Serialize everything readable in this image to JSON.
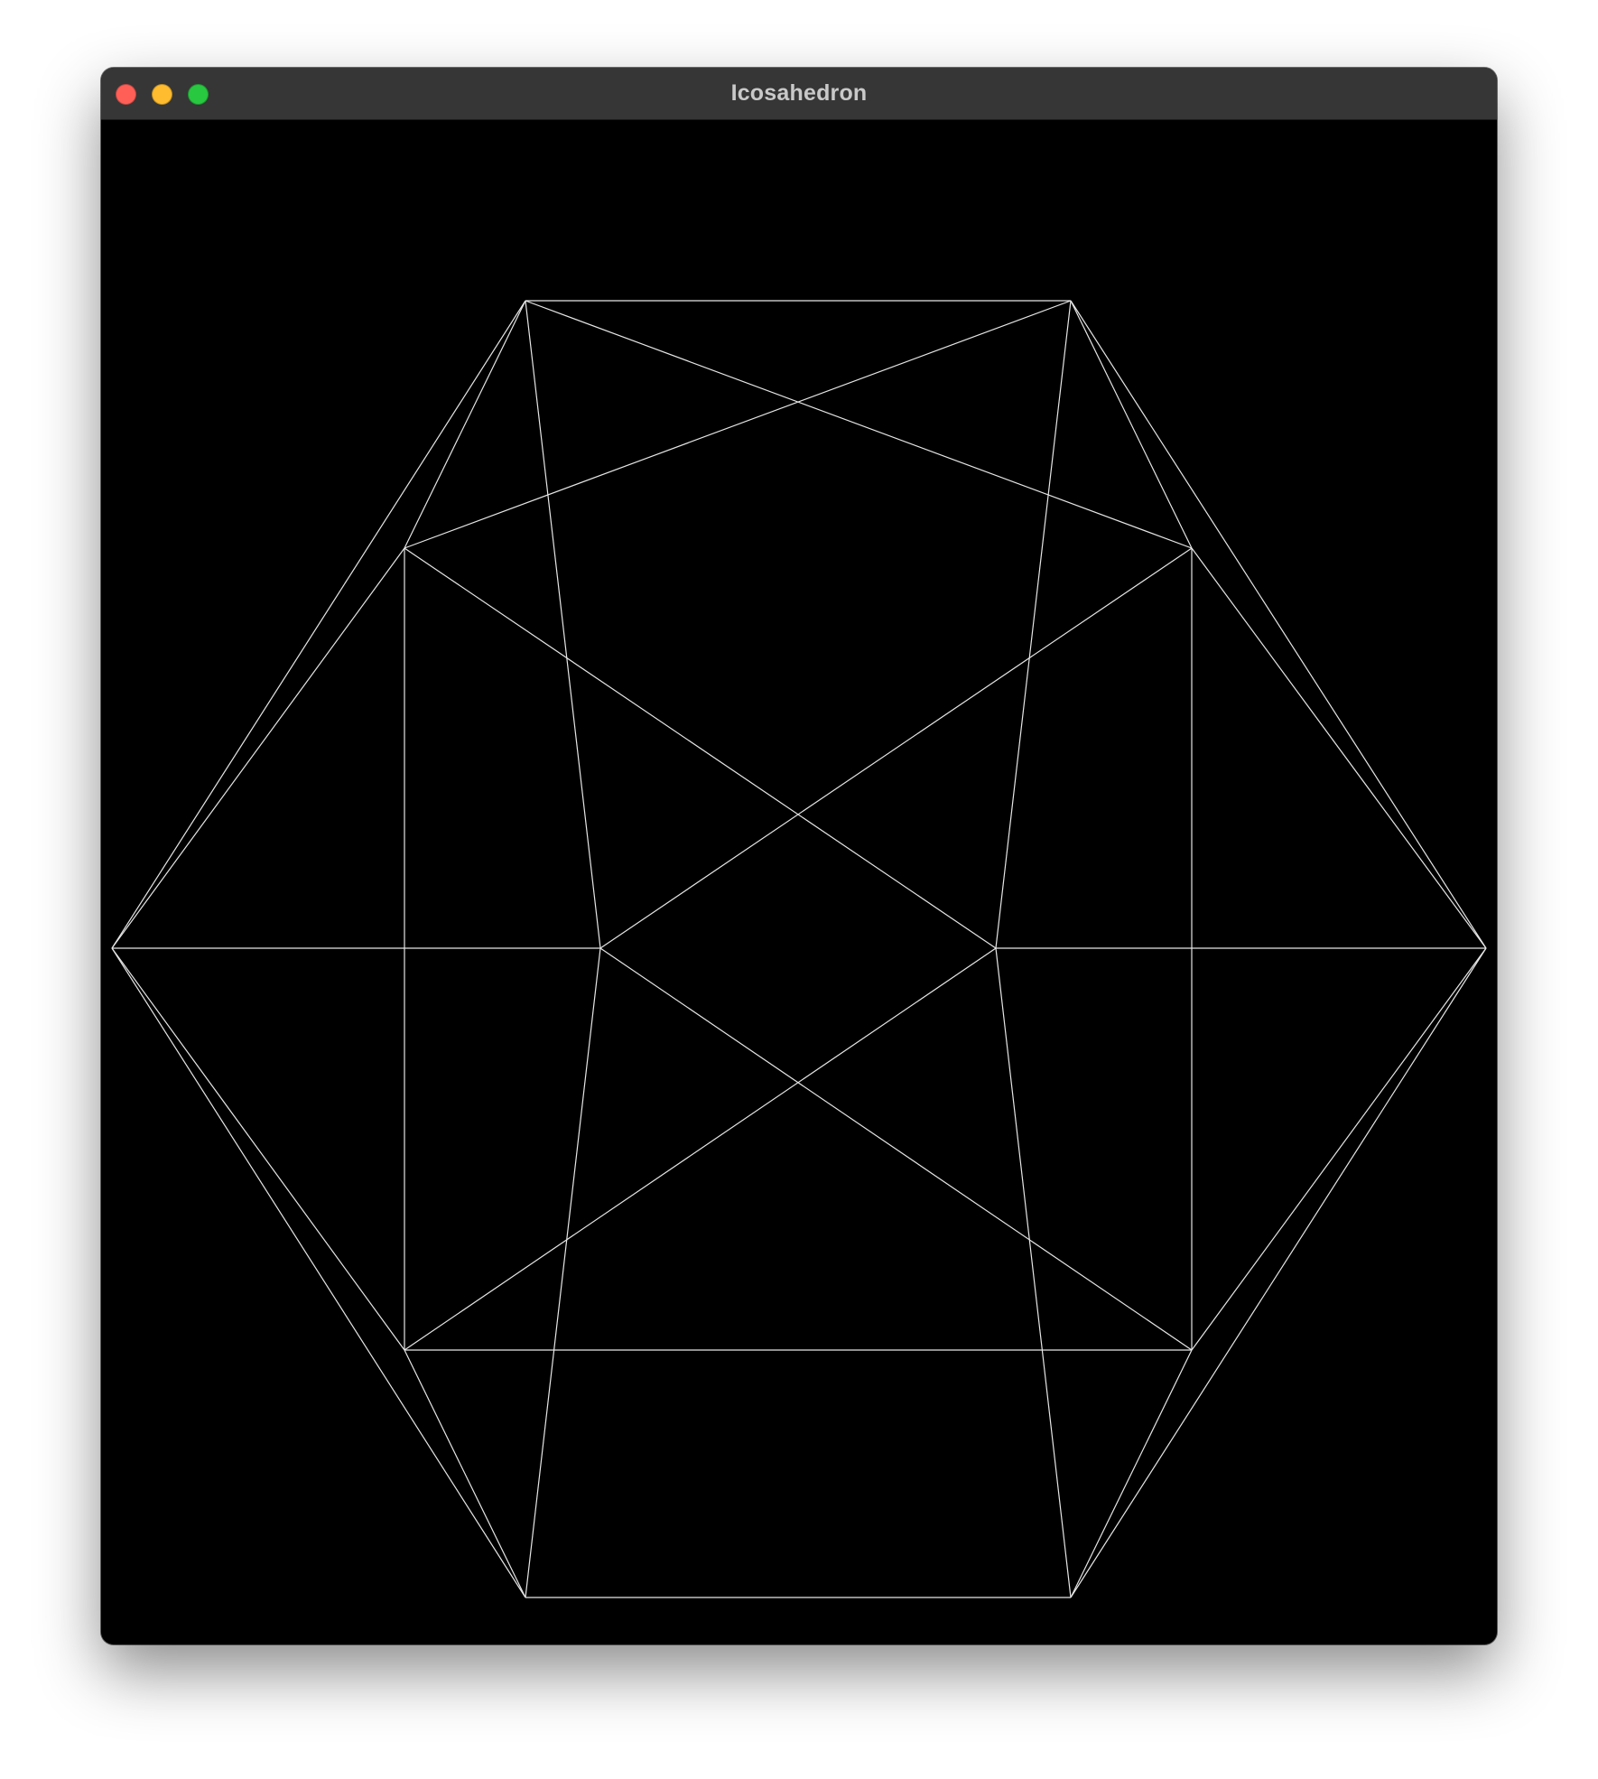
{
  "window": {
    "title": "Icosahedron",
    "title_color": "#c9c9c9",
    "titlebar_color": "#363636",
    "background_color": "#000000",
    "traffic_lights": {
      "close": {
        "icon": "close-circle-icon",
        "color": "#ff5f57"
      },
      "minimize": {
        "icon": "minimize-circle-icon",
        "color": "#febc2e"
      },
      "zoom": {
        "icon": "zoom-circle-icon",
        "color": "#28c840"
      }
    }
  },
  "viewport": {
    "shape": "icosahedron",
    "render_mode": "wireframe",
    "vertex_count": 12,
    "edge_count": 30,
    "line_color": "#e6e6e6"
  }
}
